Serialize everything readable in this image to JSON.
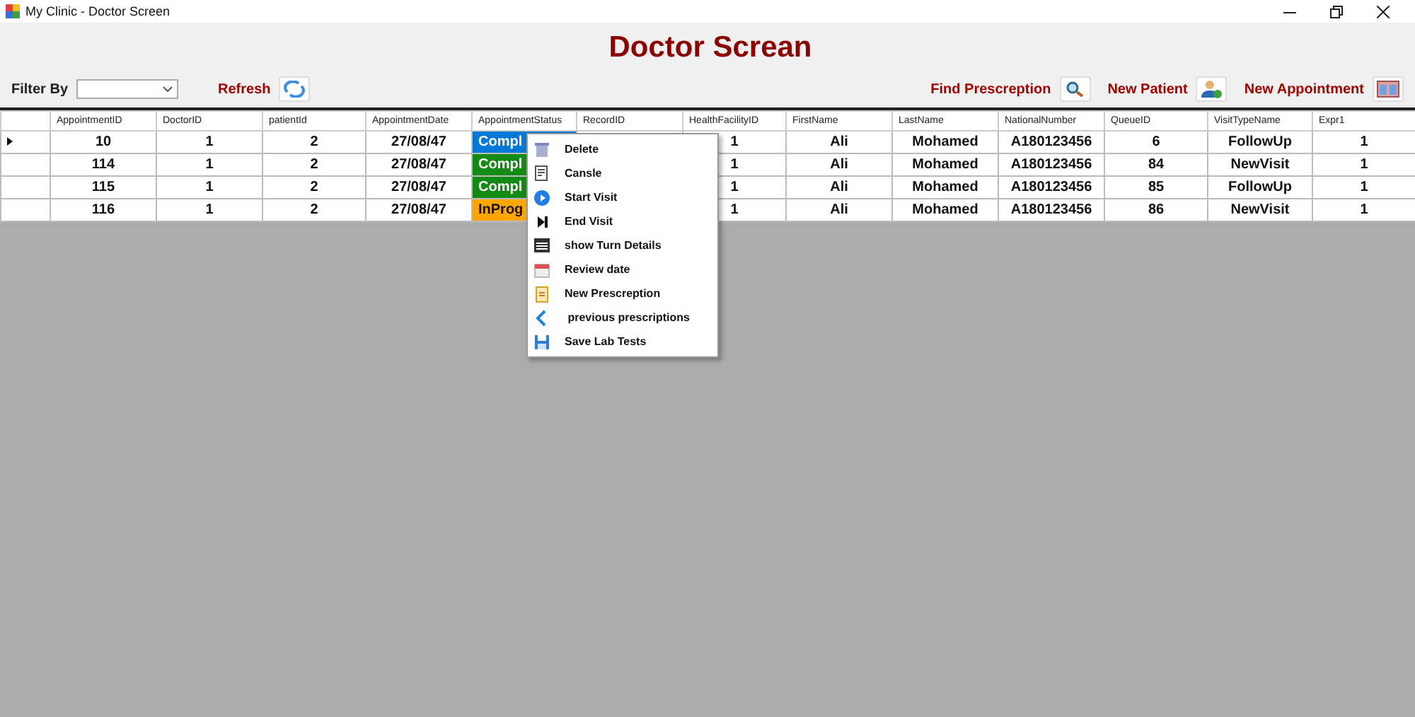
{
  "window": {
    "title": "My Clinic - Doctor Screen"
  },
  "heading": "Doctor Screan",
  "filter": {
    "label": "Filter By"
  },
  "refresh": {
    "label": "Refresh"
  },
  "actions": [
    {
      "label": "Find Prescreption",
      "kind": "search"
    },
    {
      "label": "New Patient",
      "kind": "patient"
    },
    {
      "label": "New Appointment",
      "kind": "calendar"
    }
  ],
  "table": {
    "columns": [
      "AppointmentID",
      "DoctorID",
      "patientId",
      "AppointmentDate",
      "AppointmentStatus",
      "RecordID",
      "HealthFacilityID",
      "FirstName",
      "LastName",
      "NationalNumber",
      "QueueID",
      "VisitTypeName",
      "Expr1"
    ],
    "rows": [
      {
        "selected": true,
        "appointment_id": "10",
        "doctor_id": "1",
        "patient_id": "2",
        "date": "27/08/47",
        "status": "Compl",
        "color": "#0078d7",
        "health_facility_id": "1",
        "first_name": "Ali",
        "last_name": "Mohamed",
        "national_number": "A180123456",
        "queue_id": "6",
        "visit_type": "FollowUp",
        "expr1": "1"
      },
      {
        "selected": false,
        "appointment_id": "114",
        "doctor_id": "1",
        "patient_id": "2",
        "date": "27/08/47",
        "status": "Compl",
        "color": "#138a13",
        "health_facility_id": "1",
        "first_name": "Ali",
        "last_name": "Mohamed",
        "national_number": "A180123456",
        "queue_id": "84",
        "visit_type": "NewVisit",
        "expr1": "1"
      },
      {
        "selected": false,
        "appointment_id": "115",
        "doctor_id": "1",
        "patient_id": "2",
        "date": "27/08/47",
        "status": "Compl",
        "color": "#138a13",
        "health_facility_id": "1",
        "first_name": "Ali",
        "last_name": "Mohamed",
        "national_number": "A180123456",
        "queue_id": "85",
        "visit_type": "FollowUp",
        "expr1": "1"
      },
      {
        "selected": false,
        "appointment_id": "116",
        "doctor_id": "1",
        "patient_id": "2",
        "date": "27/08/47",
        "status": "InProg",
        "color": "#ffa500",
        "health_facility_id": "1",
        "first_name": "Ali",
        "last_name": "Mohamed",
        "national_number": "A180123456",
        "queue_id": "86",
        "visit_type": "NewVisit",
        "expr1": "1"
      }
    ]
  },
  "context_menu": [
    {
      "label": "Delete",
      "kind": "trash"
    },
    {
      "label": "Cansle",
      "kind": "note"
    },
    {
      "label": "Start Visit",
      "kind": "play"
    },
    {
      "label": "End Visit",
      "kind": "end"
    },
    {
      "label": "show Turn Details",
      "kind": "details"
    },
    {
      "label": "Review date",
      "kind": "calendar"
    },
    {
      "label": "New Prescreption",
      "kind": "clipboard"
    },
    {
      "label": " previous prescriptions",
      "kind": "back"
    },
    {
      "label": "Save Lab Tests",
      "kind": "save"
    }
  ]
}
